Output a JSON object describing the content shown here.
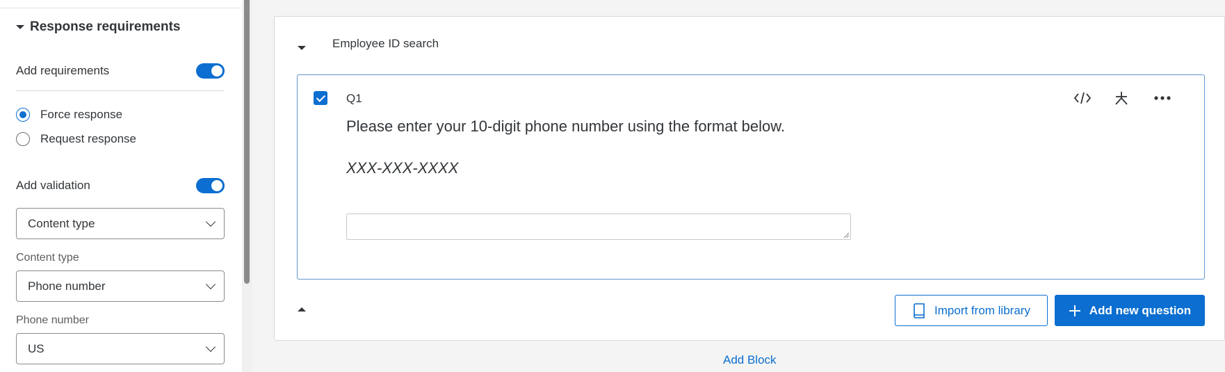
{
  "left_panel": {
    "section_title": "Response requirements",
    "add_requirements_label": "Add requirements",
    "add_requirements_on": true,
    "radio_force": "Force response",
    "radio_request": "Request response",
    "selected_radio": "Force response",
    "add_validation_label": "Add validation",
    "add_validation_on": true,
    "validation_select_value": "Content type",
    "content_type_label": "Content type",
    "content_type_value": "Phone number",
    "phone_number_label": "Phone number",
    "phone_region_value": "US"
  },
  "block": {
    "title": "Employee ID search",
    "question": {
      "id": "Q1",
      "text": "Please enter your 10-digit phone number using the format below.",
      "format_hint": "XXX-XXX-XXXX",
      "answer_value": ""
    },
    "import_label": "Import from library",
    "add_question_label": "Add new question"
  },
  "footer": {
    "add_block_label": "Add Block"
  },
  "icons": {
    "section_toggle": "caret-down-icon",
    "code": "code-icon",
    "required": "asterisk-icon",
    "more": "more-icon",
    "library": "book-icon",
    "add": "plus-icon"
  },
  "colors": {
    "accent": "#0b6ed0",
    "question_border": "#5f95cc",
    "canvas_bg": "#f4f4f4"
  }
}
